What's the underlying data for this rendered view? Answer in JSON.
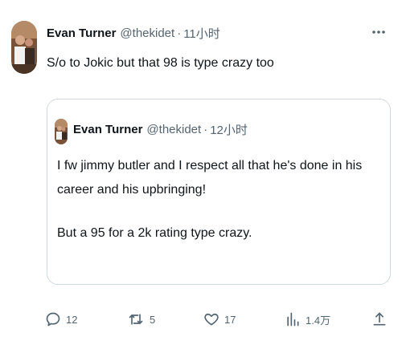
{
  "tweet": {
    "author_name": "Evan Turner",
    "author_handle": "@thekidet",
    "separator": "·",
    "time": "11小时",
    "text": "S/o to Jokic but that 98 is type crazy too",
    "more_icon": "more-horizontal-icon"
  },
  "quoted_tweet": {
    "author_name": "Evan Turner",
    "author_handle": "@thekidet",
    "separator": "·",
    "time": "12小时",
    "text_line1": "I fw jimmy butler and I respect all that he's done in his career and his upbringing!",
    "text_line2": "But a 95 for a 2k rating type crazy."
  },
  "actions": {
    "reply": {
      "icon": "reply-icon",
      "count": "12"
    },
    "retweet": {
      "icon": "retweet-icon",
      "count": "5"
    },
    "like": {
      "icon": "heart-icon",
      "count": "17"
    },
    "views": {
      "icon": "views-icon",
      "count": "1.4万"
    },
    "share": {
      "icon": "share-icon"
    }
  },
  "colors": {
    "text_primary": "#0f1419",
    "text_secondary": "#536471",
    "border": "#cfd9de",
    "background": "#ffffff"
  }
}
